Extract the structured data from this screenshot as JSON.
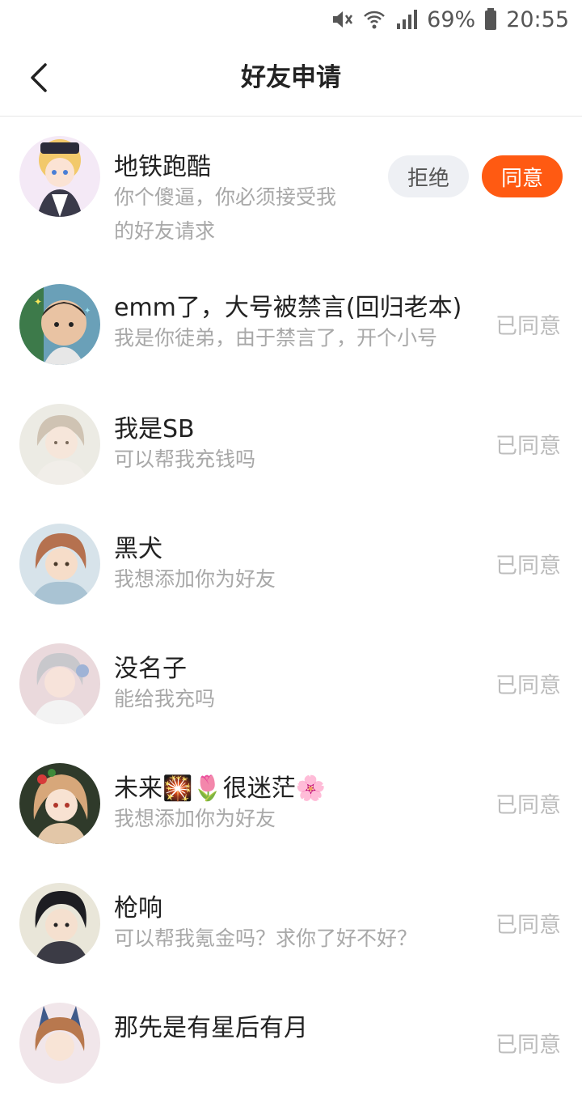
{
  "status_bar": {
    "battery": "69%",
    "time": "20:55",
    "icons": [
      "mute-icon",
      "wifi-icon",
      "signal-icon",
      "battery-icon"
    ]
  },
  "header": {
    "title": "好友申请",
    "back_icon": "chevron-left-icon"
  },
  "colors": {
    "accent": "#ff5a12",
    "reject_bg": "#eef0f4",
    "muted_text": "#a8a8a8",
    "status_text": "#bdbdbd"
  },
  "requests": [
    {
      "name": "地铁跑酷",
      "message_line1": "你个傻逼，你必须接受我",
      "message_line2": "的好友请求",
      "reject_label": "拒绝",
      "accept_label": "同意",
      "avatar_icon": "anime-avatar-icon"
    },
    {
      "name": "emm了，大号被禁言(回归老本)",
      "message": "我是你徒弟，由于禁言了，开个小号",
      "status": "已同意",
      "avatar_icon": "child-photo-avatar-icon"
    },
    {
      "name": "我是SB",
      "message": "可以帮我充钱吗",
      "status": "已同意",
      "avatar_icon": "anime-avatar-icon"
    },
    {
      "name": "黑犬",
      "message": "我想添加你为好友",
      "status": "已同意",
      "avatar_icon": "anime-avatar-icon"
    },
    {
      "name": "没名子",
      "message": "能给我充吗",
      "status": "已同意",
      "avatar_icon": "anime-avatar-icon"
    },
    {
      "name": "未来🎇🌷很迷茫🌸",
      "message": "我想添加你为好友",
      "status": "已同意",
      "avatar_icon": "anime-avatar-icon"
    },
    {
      "name": "枪响",
      "message": "可以帮我氪金吗？求你了好不好？",
      "status": "已同意",
      "avatar_icon": "anime-avatar-icon"
    },
    {
      "name": "那先是有星后有月",
      "message": "",
      "status": "已同意",
      "avatar_icon": "anime-avatar-icon"
    }
  ]
}
